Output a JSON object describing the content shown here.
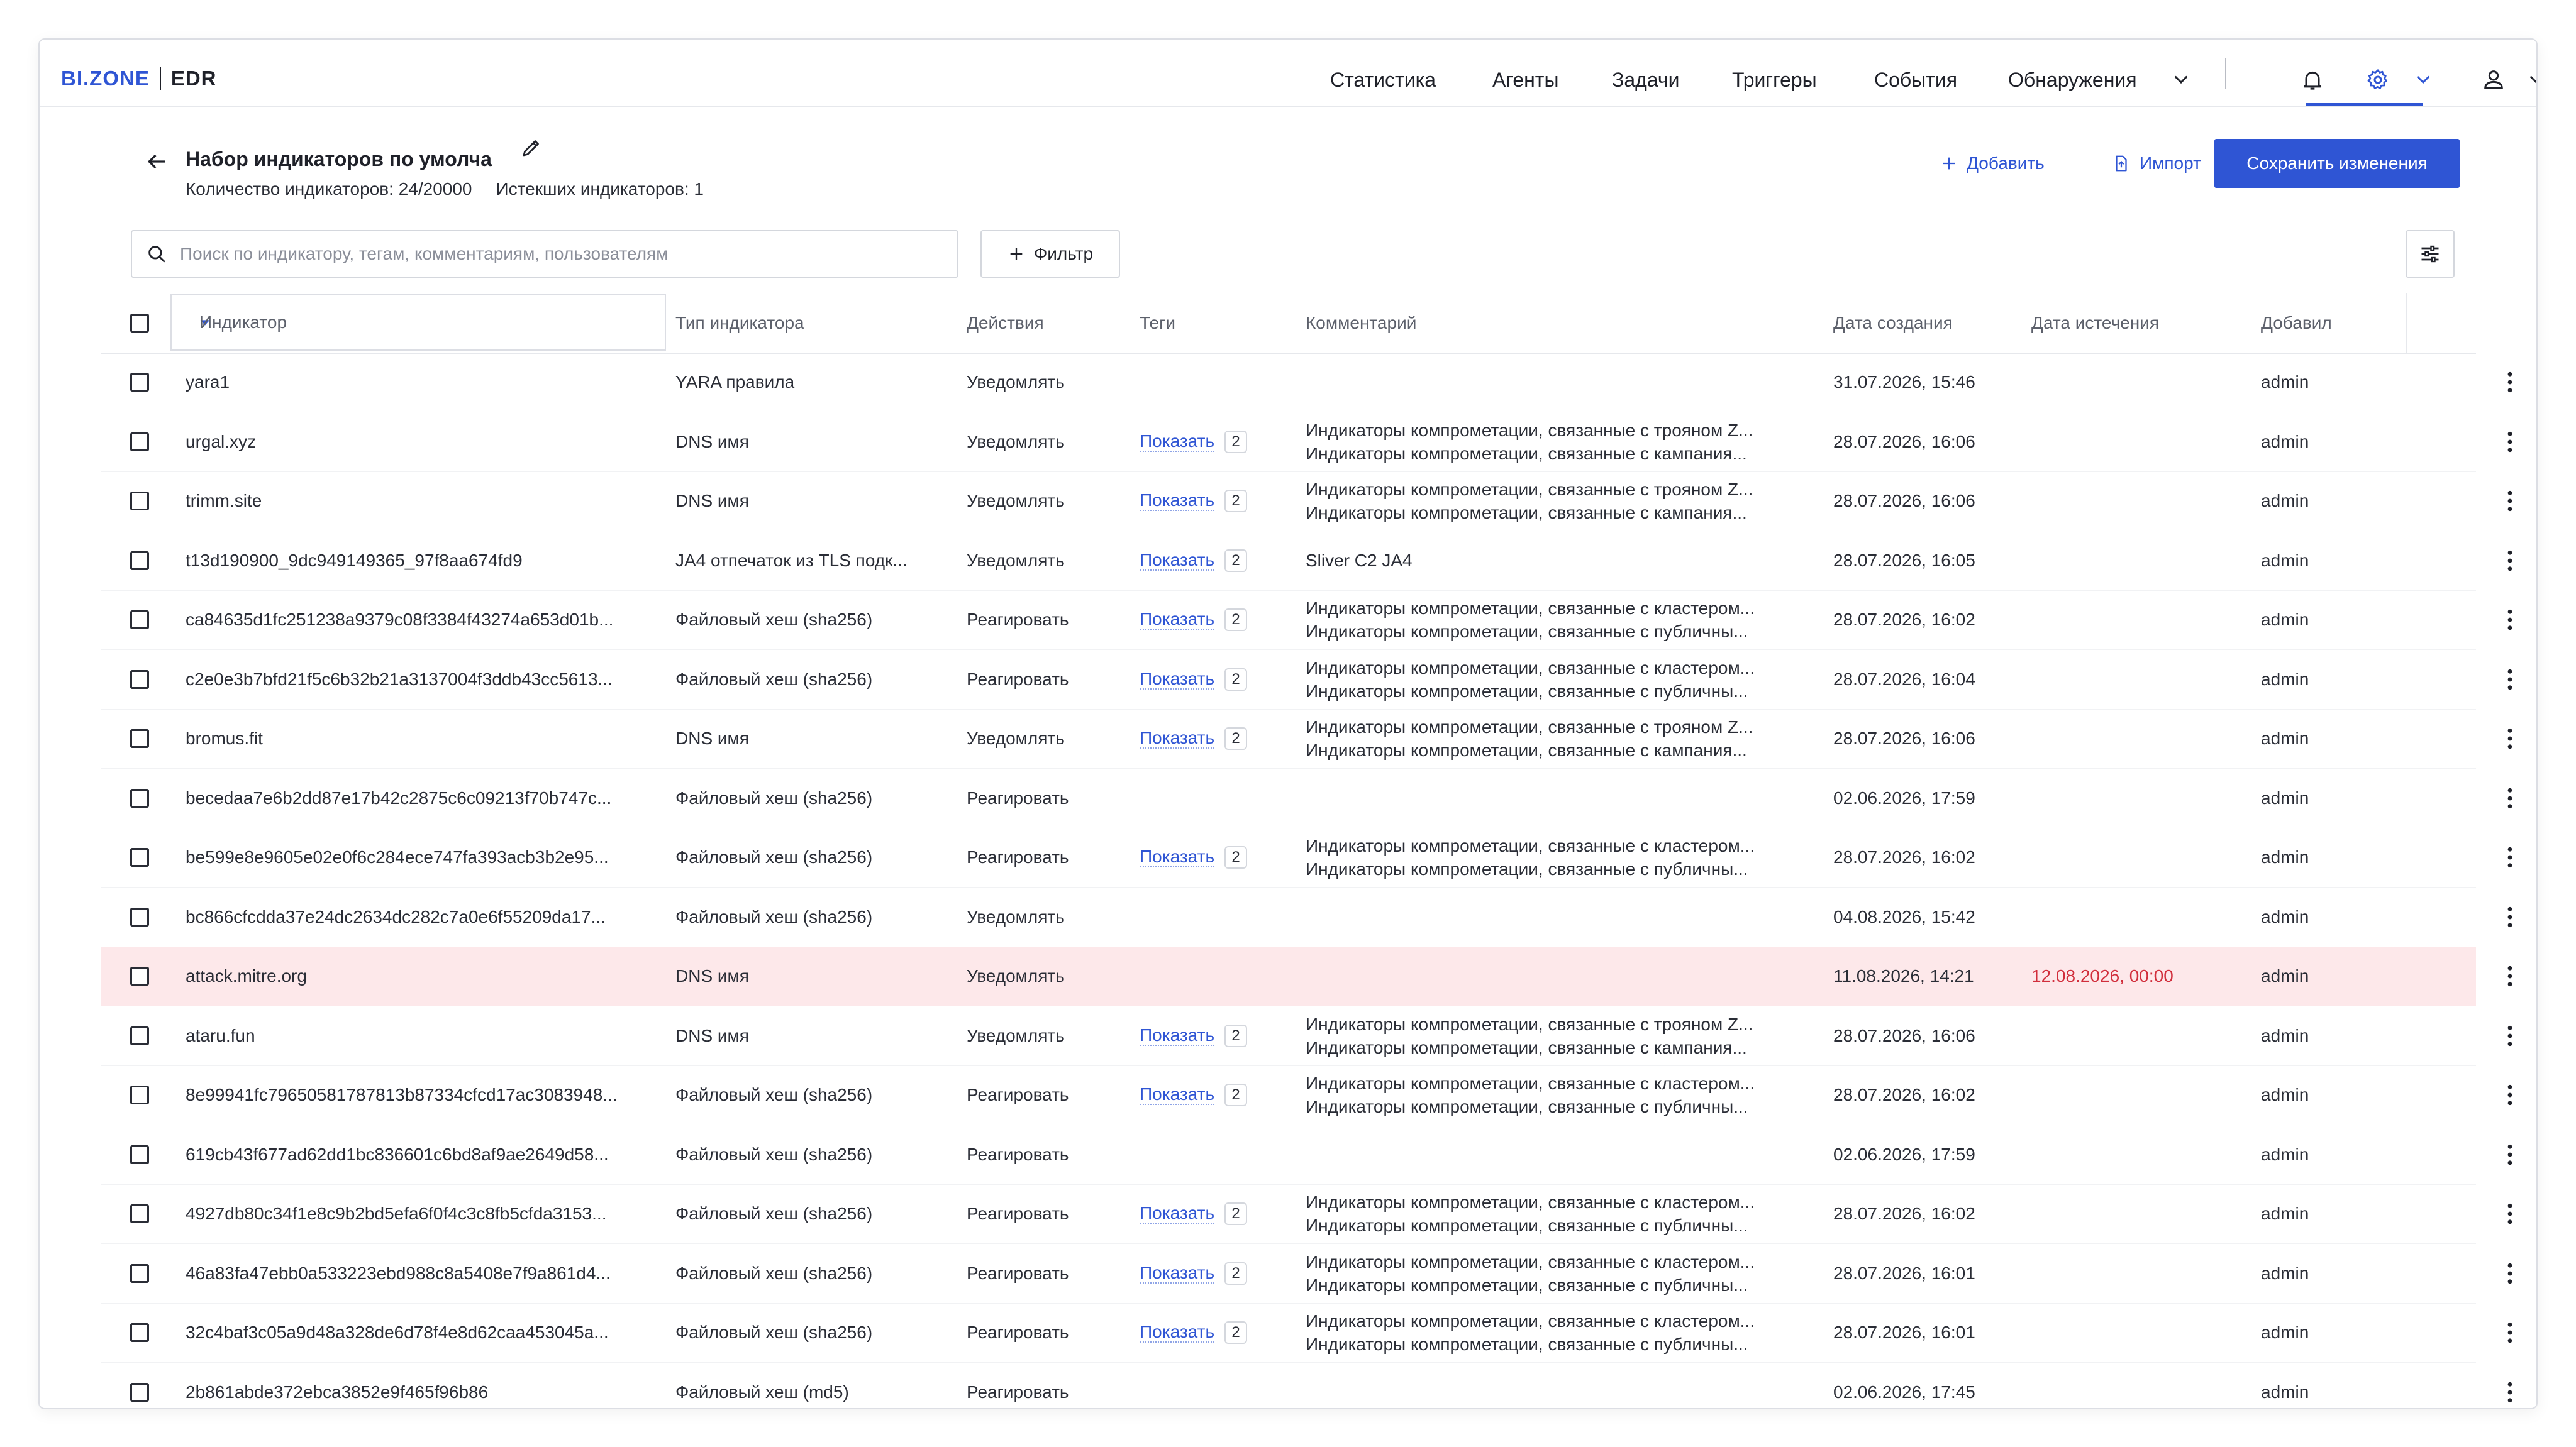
{
  "header": {
    "logo_brand": "BI.ZONE",
    "logo_product": "EDR",
    "nav": [
      {
        "label": "Статистика"
      },
      {
        "label": "Агенты"
      },
      {
        "label": "Задачи"
      },
      {
        "label": "Триггеры"
      },
      {
        "label": "События"
      },
      {
        "label": "Обнаружения"
      }
    ],
    "icons": [
      "bell-icon",
      "gear-icon",
      "user-icon",
      "chevron-down-icon"
    ],
    "accent": "#2f55d4"
  },
  "page": {
    "title": "Набор индикаторов по умолча",
    "count_text": "Количество индикаторов: 24/20000",
    "expiring_text": "Истекших индикаторов: 1",
    "add_label": "Добавить",
    "import_label": "Импорт",
    "save_label": "Сохранить изменения"
  },
  "search": {
    "placeholder": "Поиск по индикатору, тегам, комментариям, пользователям",
    "value": "",
    "filter_label": "Фильтр"
  },
  "table": {
    "columns": [
      "Индикатор",
      "Тип индикатора",
      "Действия",
      "Теги",
      "Комментарий",
      "Дата создания",
      "Дата истечения",
      "Добавил"
    ],
    "expired_color": "#d12e3c",
    "rows": [
      {
        "indicator": "yara1",
        "type": "YARA правила",
        "action": "Уведомлять",
        "tags": "",
        "tag_count": "",
        "comment1": "",
        "comment2": "",
        "created": "31.07.2026, 15:46",
        "expires": "",
        "added_by": "admin"
      },
      {
        "indicator": "urgal.xyz",
        "type": "DNS имя",
        "action": "Уведомлять",
        "tags": "Показать",
        "tag_count": "2",
        "comment1": "Индикаторы компрометации, связанные с трояном Z...",
        "comment2": "Индикаторы компрометации, связанные с кампания...",
        "created": "28.07.2026, 16:06",
        "expires": "",
        "added_by": "admin"
      },
      {
        "indicator": "trimm.site",
        "type": "DNS имя",
        "action": "Уведомлять",
        "tags": "Показать",
        "tag_count": "2",
        "comment1": "Индикаторы компрометации, связанные с трояном Z...",
        "comment2": "Индикаторы компрометации, связанные с кампания...",
        "created": "28.07.2026, 16:06",
        "expires": "",
        "added_by": "admin"
      },
      {
        "indicator": "t13d190900_9dc949149365_97f8aa674fd9",
        "type": "JA4 отпечаток из TLS подк...",
        "action": "Уведомлять",
        "tags": "Показать",
        "tag_count": "2",
        "comment1": "Sliver C2 JA4",
        "comment2": "",
        "created": "28.07.2026, 16:05",
        "expires": "",
        "added_by": "admin"
      },
      {
        "indicator": "ca84635d1fc251238a9379c08f3384f43274a653d01b...",
        "type": "Файловый хеш (sha256)",
        "action": "Реагировать",
        "tags": "Показать",
        "tag_count": "2",
        "comment1": "Индикаторы компрометации, связанные с кластером...",
        "comment2": "Индикаторы компрометации, связанные с публичны...",
        "created": "28.07.2026, 16:02",
        "expires": "",
        "added_by": "admin"
      },
      {
        "indicator": "c2e0e3b7bfd21f5c6b32b21a3137004f3ddb43cc5613...",
        "type": "Файловый хеш (sha256)",
        "action": "Реагировать",
        "tags": "Показать",
        "tag_count": "2",
        "comment1": "Индикаторы компрометации, связанные с кластером...",
        "comment2": "Индикаторы компрометации, связанные с публичны...",
        "created": "28.07.2026, 16:04",
        "expires": "",
        "added_by": "admin"
      },
      {
        "indicator": "bromus.fit",
        "type": "DNS имя",
        "action": "Уведомлять",
        "tags": "Показать",
        "tag_count": "2",
        "comment1": "Индикаторы компрометации, связанные с трояном Z...",
        "comment2": "Индикаторы компрометации, связанные с кампания...",
        "created": "28.07.2026, 16:06",
        "expires": "",
        "added_by": "admin"
      },
      {
        "indicator": "becedaa7e6b2dd87e17b42c2875c6c09213f70b747c...",
        "type": "Файловый хеш (sha256)",
        "action": "Реагировать",
        "tags": "",
        "tag_count": "",
        "comment1": "",
        "comment2": "",
        "created": "02.06.2026, 17:59",
        "expires": "",
        "added_by": "admin"
      },
      {
        "indicator": "be599e8e9605e02e0f6c284ece747fa393acb3b2e95...",
        "type": "Файловый хеш (sha256)",
        "action": "Реагировать",
        "tags": "Показать",
        "tag_count": "2",
        "comment1": "Индикаторы компрометации, связанные с кластером...",
        "comment2": "Индикаторы компрометации, связанные с публичны...",
        "created": "28.07.2026, 16:02",
        "expires": "",
        "added_by": "admin"
      },
      {
        "indicator": "bc866cfcdda37e24dc2634dc282c7a0e6f55209da17...",
        "type": "Файловый хеш (sha256)",
        "action": "Уведомлять",
        "tags": "",
        "tag_count": "",
        "comment1": "",
        "comment2": "",
        "created": "04.08.2026, 15:42",
        "expires": "",
        "added_by": "admin"
      },
      {
        "indicator": "attack.mitre.org",
        "type": "DNS имя",
        "action": "Уведомлять",
        "tags": "",
        "tag_count": "",
        "comment1": "",
        "comment2": "",
        "created": "11.08.2026, 14:21",
        "expires": "12.08.2026, 00:00",
        "added_by": "admin",
        "expired": true
      },
      {
        "indicator": "ataru.fun",
        "type": "DNS имя",
        "action": "Уведомлять",
        "tags": "Показать",
        "tag_count": "2",
        "comment1": "Индикаторы компрометации, связанные с трояном Z...",
        "comment2": "Индикаторы компрометации, связанные с кампания...",
        "created": "28.07.2026, 16:06",
        "expires": "",
        "added_by": "admin"
      },
      {
        "indicator": "8e99941fc79650581787813b87334cfcd17ac3083948...",
        "type": "Файловый хеш (sha256)",
        "action": "Реагировать",
        "tags": "Показать",
        "tag_count": "2",
        "comment1": "Индикаторы компрометации, связанные с кластером...",
        "comment2": "Индикаторы компрометации, связанные с публичны...",
        "created": "28.07.2026, 16:02",
        "expires": "",
        "added_by": "admin"
      },
      {
        "indicator": "619cb43f677ad62dd1bc836601c6bd8af9ae2649d58...",
        "type": "Файловый хеш (sha256)",
        "action": "Реагировать",
        "tags": "",
        "tag_count": "",
        "comment1": "",
        "comment2": "",
        "created": "02.06.2026, 17:59",
        "expires": "",
        "added_by": "admin"
      },
      {
        "indicator": "4927db80c34f1e8c9b2bd5efa6f0f4c3c8fb5cfda3153...",
        "type": "Файловый хеш (sha256)",
        "action": "Реагировать",
        "tags": "Показать",
        "tag_count": "2",
        "comment1": "Индикаторы компрометации, связанные с кластером...",
        "comment2": "Индикаторы компрометации, связанные с публичны...",
        "created": "28.07.2026, 16:02",
        "expires": "",
        "added_by": "admin"
      },
      {
        "indicator": "46a83fa47ebb0a533223ebd988c8a5408e7f9a861d4...",
        "type": "Файловый хеш (sha256)",
        "action": "Реагировать",
        "tags": "Показать",
        "tag_count": "2",
        "comment1": "Индикаторы компрометации, связанные с кластером...",
        "comment2": "Индикаторы компрометации, связанные с публичны...",
        "created": "28.07.2026, 16:01",
        "expires": "",
        "added_by": "admin"
      },
      {
        "indicator": "32c4baf3c05a9d48a328de6d78f4e8d62caa453045a...",
        "type": "Файловый хеш (sha256)",
        "action": "Реагировать",
        "tags": "Показать",
        "tag_count": "2",
        "comment1": "Индикаторы компрометации, связанные с кластером...",
        "comment2": "Индикаторы компрометации, связанные с публичны...",
        "created": "28.07.2026, 16:01",
        "expires": "",
        "added_by": "admin"
      },
      {
        "indicator": "2b861abde372ebca3852e9f465f96b86",
        "type": "Файловый хеш (md5)",
        "action": "Реагировать",
        "tags": "",
        "tag_count": "",
        "comment1": "",
        "comment2": "",
        "created": "02.06.2026, 17:45",
        "expires": "",
        "added_by": "admin"
      }
    ]
  }
}
